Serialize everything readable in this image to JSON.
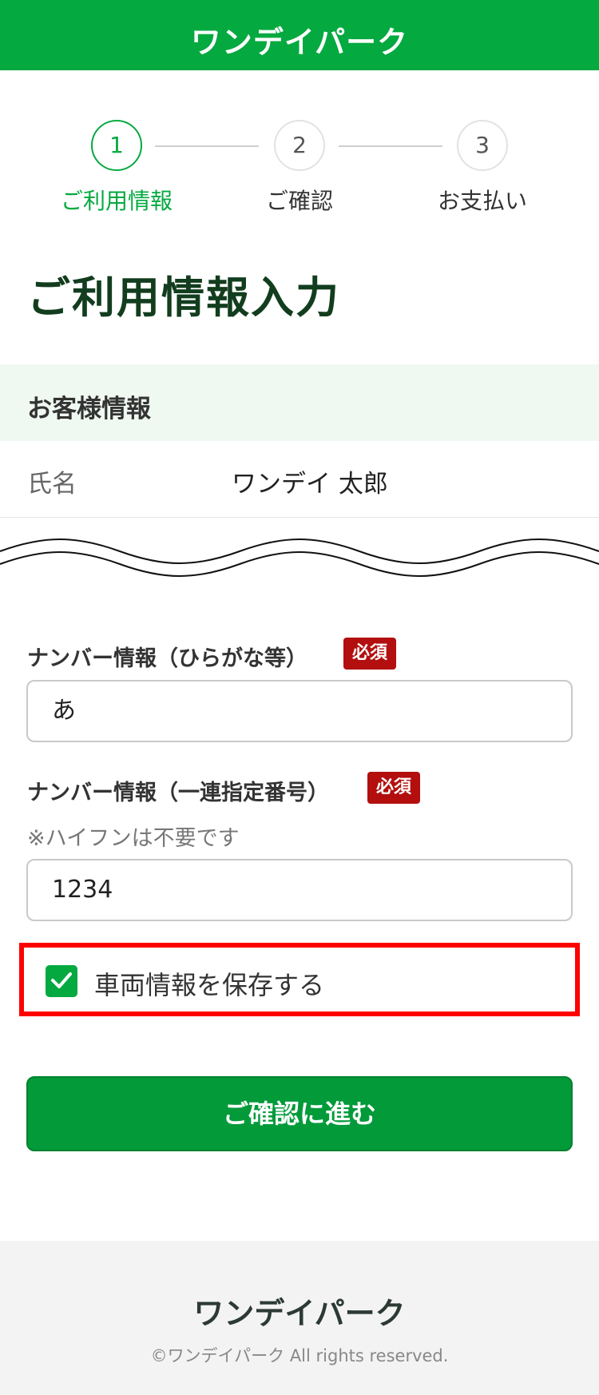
{
  "header": {
    "logo_text": "ワンデイパーク"
  },
  "stepper": {
    "steps": [
      {
        "number": "1",
        "label": "ご利用情報",
        "active": true
      },
      {
        "number": "2",
        "label": "ご確認",
        "active": false
      },
      {
        "number": "3",
        "label": "お支払い",
        "active": false
      }
    ]
  },
  "page_title": "ご利用情報入力",
  "customer_section": {
    "title": "お客様情報",
    "name_label": "氏名",
    "name_value": "ワンデイ 太郎"
  },
  "plate_kana": {
    "label": "ナンバー情報（ひらがな等）",
    "required_badge": "必須",
    "value": "あ"
  },
  "plate_number": {
    "label": "ナンバー情報（一連指定番号）",
    "required_badge": "必須",
    "hint": "※ハイフンは不要です",
    "value": "1234"
  },
  "save_vehicle": {
    "label": "車両情報を保存する",
    "checked": true
  },
  "submit": {
    "label": "ご確認に進む"
  },
  "footer": {
    "logo_text": "ワンデイパーク",
    "copyright": "©ワンデイパーク All rights reserved."
  },
  "colors": {
    "brand_green": "#04a940",
    "required_red": "#b30f0f",
    "highlight_red": "#ff0000"
  }
}
